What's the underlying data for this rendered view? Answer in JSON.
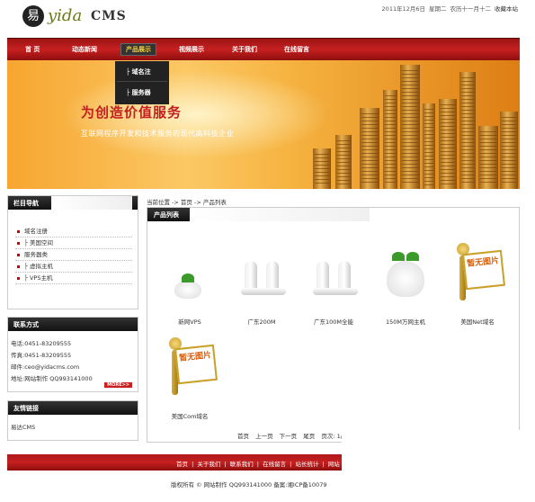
{
  "header": {
    "logo_glyph": "易",
    "logo_brand": "yida",
    "logo_cms": "CMS",
    "date": "2011年12月6日",
    "weekday": "星期二",
    "lunar": "农历十一月十二",
    "favorite": "收藏本站"
  },
  "nav": {
    "items": [
      "首 页",
      "动态新闻",
      "产品展示",
      "视频展示",
      "关于我们",
      "在线留言"
    ],
    "active_index": 2,
    "dropdown": [
      "域名注",
      "服务器"
    ]
  },
  "banner": {
    "title": "为创造价值服务",
    "subtitle": "互联网程序开发和技术服务的现代高科技企业"
  },
  "sidebar": {
    "categories_title": "栏目导航",
    "categories": [
      "域名注册",
      "美国空间",
      "服务器类",
      "虚拟主机",
      "VPS主机"
    ],
    "contact_title": "联系方式",
    "contact": [
      "电话:0451-83209555",
      "传真:0451-83209555",
      "邮件:ceo@yidacms.com",
      "地址:网站制作  QQ993141000"
    ],
    "more_label": "MORE>>",
    "links_title": "友情链接",
    "links": [
      "易达CMS"
    ]
  },
  "content": {
    "breadcrumb": "当前位置 -> 首页 -> 产品列表",
    "list_title": "产品列表",
    "products": [
      "新网VPS",
      "广东200M",
      "广东100M全能",
      "150M万网主机",
      "美国Net域名",
      "美国Com域名"
    ],
    "no_image_text": "暂无图片",
    "pager": [
      "首页",
      "上一页",
      "下一页",
      "尾页",
      "页次: 1/"
    ]
  },
  "footer": {
    "links": [
      "首页",
      "|",
      "关于我们",
      "|",
      "联系我们",
      "|",
      "在线留言",
      "|",
      "站长统计",
      "|",
      "网站"
    ],
    "copyright": "版权所有 © 网站制作 QQ993141000 备案:湘ICP备10079"
  },
  "colors": {
    "accent_red": "#c62020",
    "dark": "#222222",
    "banner_orange": "#f7a630"
  }
}
